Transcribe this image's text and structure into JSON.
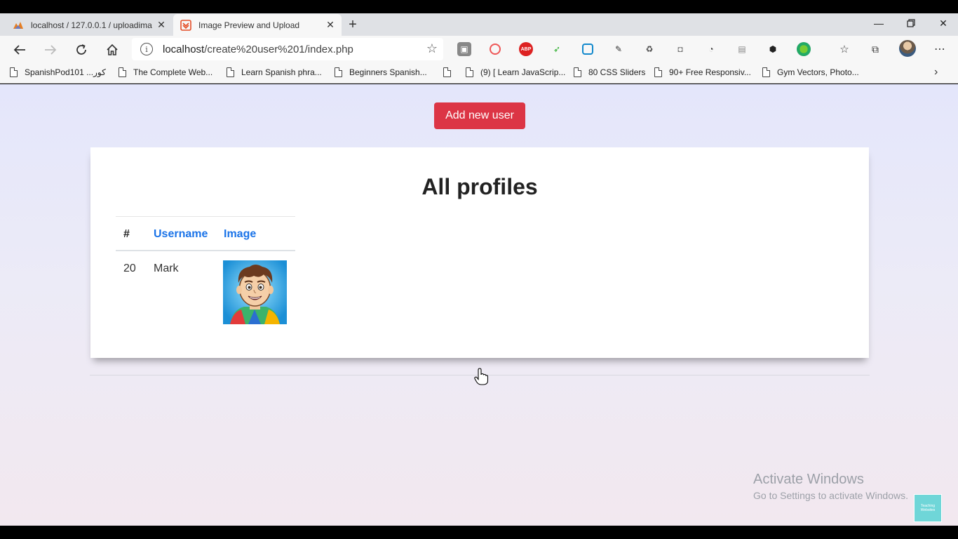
{
  "browser": {
    "tabs": [
      {
        "title": "localhost / 127.0.0.1 / uploadima",
        "favicon": "phpmyadmin-icon"
      },
      {
        "title": "Image Preview and Upload",
        "favicon": "html-icon"
      }
    ],
    "address": {
      "host": "localhost",
      "path": "/create%20user%201/index.php"
    },
    "bookmarks": [
      "SpanishPod101 ...كور",
      "The Complete Web...",
      "Learn Spanish phra...",
      "Beginners Spanish...",
      "",
      "(9) [ Learn JavaScrip...",
      "80 CSS Sliders",
      "90+ Free Responsiv...",
      "Gym Vectors, Photo..."
    ]
  },
  "page": {
    "add_button": "Add new user",
    "heading": "All profiles",
    "table": {
      "headers": [
        "#",
        "Username",
        "Image"
      ],
      "rows": [
        {
          "id": "20",
          "username": "Mark"
        }
      ]
    },
    "accent": "#dc3545",
    "link_color": "#1a73e8"
  },
  "watermark": {
    "line1": "Activate Windows",
    "line2": "Go to Settings to activate Windows."
  },
  "badge": "Teaching Websites"
}
